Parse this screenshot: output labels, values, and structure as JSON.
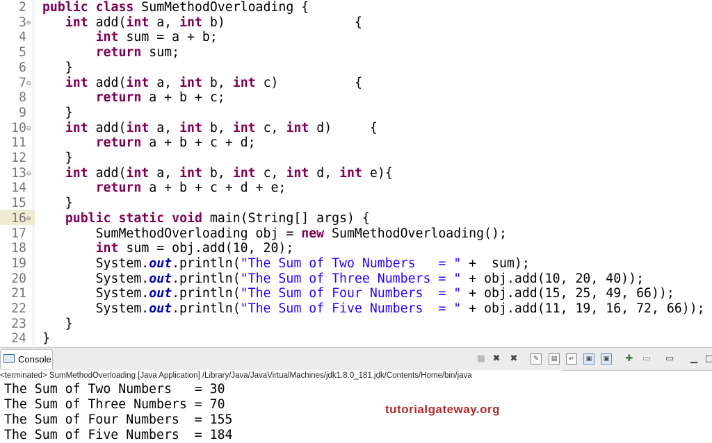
{
  "editor": {
    "lines": [
      {
        "n": "2",
        "fold": "",
        "segs": [
          {
            "t": " "
          },
          {
            "t": "public",
            "c": "kw"
          },
          {
            "t": " "
          },
          {
            "t": "class",
            "c": "kw"
          },
          {
            "t": " SumMethodOverloading {"
          }
        ]
      },
      {
        "n": "3",
        "fold": "⊖",
        "segs": [
          {
            "t": "    "
          },
          {
            "t": "int",
            "c": "kw"
          },
          {
            "t": " add("
          },
          {
            "t": "int",
            "c": "kw"
          },
          {
            "t": " a, "
          },
          {
            "t": "int",
            "c": "kw"
          },
          {
            "t": " b)                 {"
          }
        ]
      },
      {
        "n": "4",
        "fold": "",
        "segs": [
          {
            "t": "        "
          },
          {
            "t": "int",
            "c": "kw"
          },
          {
            "t": " sum = a + b;"
          }
        ]
      },
      {
        "n": "5",
        "fold": "",
        "segs": [
          {
            "t": "        "
          },
          {
            "t": "return",
            "c": "kw"
          },
          {
            "t": " sum;"
          }
        ]
      },
      {
        "n": "6",
        "fold": "",
        "segs": [
          {
            "t": "    }"
          }
        ]
      },
      {
        "n": "7",
        "fold": "⊖",
        "segs": [
          {
            "t": "    "
          },
          {
            "t": "int",
            "c": "kw"
          },
          {
            "t": " add("
          },
          {
            "t": "int",
            "c": "kw"
          },
          {
            "t": " a, "
          },
          {
            "t": "int",
            "c": "kw"
          },
          {
            "t": " b, "
          },
          {
            "t": "int",
            "c": "kw"
          },
          {
            "t": " c)          {"
          }
        ]
      },
      {
        "n": "8",
        "fold": "",
        "segs": [
          {
            "t": "        "
          },
          {
            "t": "return",
            "c": "kw"
          },
          {
            "t": " a + b + c;"
          }
        ]
      },
      {
        "n": "9",
        "fold": "",
        "segs": [
          {
            "t": "    }"
          }
        ]
      },
      {
        "n": "10",
        "fold": "⊖",
        "segs": [
          {
            "t": "    "
          },
          {
            "t": "int",
            "c": "kw"
          },
          {
            "t": " add("
          },
          {
            "t": "int",
            "c": "kw"
          },
          {
            "t": " a, "
          },
          {
            "t": "int",
            "c": "kw"
          },
          {
            "t": " b, "
          },
          {
            "t": "int",
            "c": "kw"
          },
          {
            "t": " c, "
          },
          {
            "t": "int",
            "c": "kw"
          },
          {
            "t": " d)     {"
          }
        ]
      },
      {
        "n": "11",
        "fold": "",
        "segs": [
          {
            "t": "        "
          },
          {
            "t": "return",
            "c": "kw"
          },
          {
            "t": " a + b + c + d;"
          }
        ]
      },
      {
        "n": "12",
        "fold": "",
        "segs": [
          {
            "t": "    }"
          }
        ]
      },
      {
        "n": "13",
        "fold": "⊖",
        "segs": [
          {
            "t": "    "
          },
          {
            "t": "int",
            "c": "kw"
          },
          {
            "t": " add("
          },
          {
            "t": "int",
            "c": "kw"
          },
          {
            "t": " a, "
          },
          {
            "t": "int",
            "c": "kw"
          },
          {
            "t": " b, "
          },
          {
            "t": "int",
            "c": "kw"
          },
          {
            "t": " c, "
          },
          {
            "t": "int",
            "c": "kw"
          },
          {
            "t": " d, "
          },
          {
            "t": "int",
            "c": "kw"
          },
          {
            "t": " e){"
          }
        ]
      },
      {
        "n": "14",
        "fold": "",
        "segs": [
          {
            "t": "        "
          },
          {
            "t": "return",
            "c": "kw"
          },
          {
            "t": " a + b + c + d + e;"
          }
        ]
      },
      {
        "n": "15",
        "fold": "",
        "segs": [
          {
            "t": "    }"
          }
        ]
      },
      {
        "n": "16",
        "fold": "⊖",
        "segs": [
          {
            "t": "    "
          },
          {
            "t": "public",
            "c": "kw"
          },
          {
            "t": " "
          },
          {
            "t": "static",
            "c": "kw"
          },
          {
            "t": " "
          },
          {
            "t": "void",
            "c": "kw"
          },
          {
            "t": " main(String[] args) {"
          }
        ]
      },
      {
        "n": "17",
        "fold": "",
        "segs": [
          {
            "t": "        SumMethodOverloading obj = "
          },
          {
            "t": "new",
            "c": "kw"
          },
          {
            "t": " SumMethodOverloading();"
          }
        ]
      },
      {
        "n": "18",
        "fold": "",
        "segs": [
          {
            "t": "        "
          },
          {
            "t": "int",
            "c": "kw"
          },
          {
            "t": " sum = obj.add(10, 20);"
          }
        ]
      },
      {
        "n": "19",
        "fold": "",
        "segs": [
          {
            "t": "        System."
          },
          {
            "t": "out",
            "c": "fld"
          },
          {
            "t": ".println("
          },
          {
            "t": "\"The Sum of Two Numbers   = \"",
            "c": "str"
          },
          {
            "t": " +  sum);"
          }
        ]
      },
      {
        "n": "20",
        "fold": "",
        "segs": [
          {
            "t": "        System."
          },
          {
            "t": "out",
            "c": "fld"
          },
          {
            "t": ".println("
          },
          {
            "t": "\"The Sum of Three Numbers = \"",
            "c": "str"
          },
          {
            "t": " + obj.add(10, 20, 40));"
          }
        ]
      },
      {
        "n": "21",
        "fold": "",
        "segs": [
          {
            "t": "        System."
          },
          {
            "t": "out",
            "c": "fld"
          },
          {
            "t": ".println("
          },
          {
            "t": "\"The Sum of Four Numbers  = \"",
            "c": "str"
          },
          {
            "t": " + obj.add(15, 25, 49, 66));"
          }
        ]
      },
      {
        "n": "22",
        "fold": "",
        "segs": [
          {
            "t": "        System."
          },
          {
            "t": "out",
            "c": "fld"
          },
          {
            "t": ".println("
          },
          {
            "t": "\"The Sum of Five Numbers  = \"",
            "c": "str"
          },
          {
            "t": " + obj.add(11, 19, 16, 72, 66));"
          }
        ]
      },
      {
        "n": "23",
        "fold": "",
        "segs": [
          {
            "t": "    }"
          }
        ]
      },
      {
        "n": "24",
        "fold": "",
        "segs": [
          {
            "t": " }"
          }
        ]
      }
    ]
  },
  "console": {
    "tab_label": "Console",
    "tab_icon": "console-icon",
    "toolbar_icons": [
      "terminate-icon",
      "remove-launch-icon",
      "remove-all-terminated-icon",
      "clear-console-icon",
      "scroll-lock-icon",
      "word-wrap-icon",
      "show-on-stdout-icon",
      "show-on-stderr-icon",
      "pin-console-icon",
      "display-console-icon",
      "open-console-icon",
      "minimize-icon",
      "maximize-icon"
    ],
    "status": "<terminated> SumMethodOverloading [Java Application] /Library/Java/JavaVirtualMachines/jdk1.8.0_181.jdk/Contents/Home/bin/java",
    "output": [
      "The Sum of Two Numbers   = 30",
      "The Sum of Three Numbers = 70",
      "The Sum of Four Numbers  = 155",
      "The Sum of Five Numbers  = 184"
    ]
  },
  "watermark": "tutorialgateway.org"
}
